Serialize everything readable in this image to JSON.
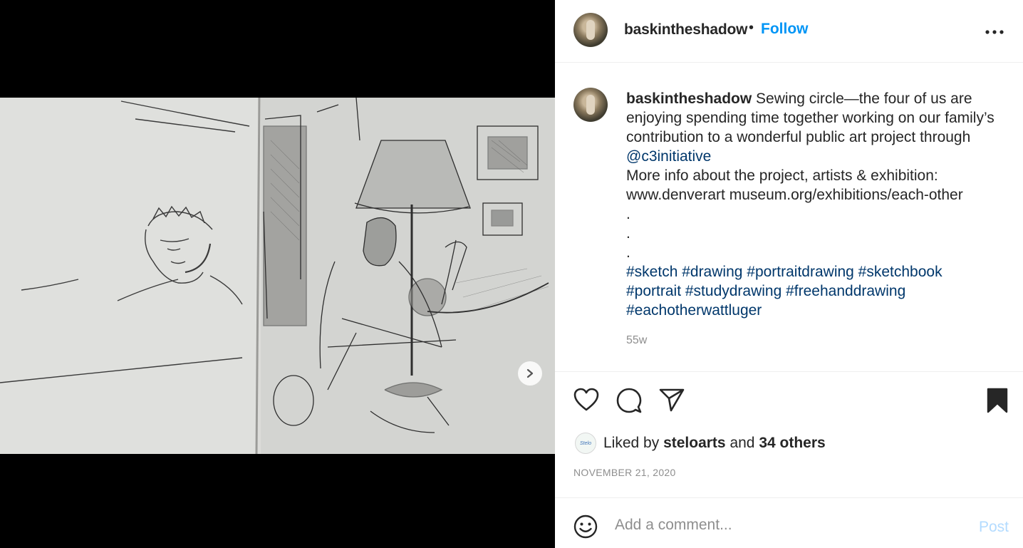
{
  "header": {
    "username": "baskintheshadow",
    "bullet": "•",
    "follow_label": "Follow",
    "more_label": "•••"
  },
  "media": {
    "carousel_slide_count": 3,
    "active_slide": 1
  },
  "caption": {
    "username": "baskintheshadow",
    "line1": "Sewing circle—the four of us are",
    "line2": "enjoying spending time together working on our family’s",
    "line3": "contribution to a wonderful public art project through",
    "mention": "@c3initiative",
    "line5": "More info about the project, artists & exhibition:",
    "line6": "www.denverart museum.org/exhibitions/each-other",
    "dot1": ".",
    "dot2": ".",
    "dot3": ".",
    "hashtags_line1": "#sketch #drawing #portraitdrawing #sketchbook",
    "hashtags_line2": "#portrait #studydrawing #freehanddrawing",
    "hashtags_line3": "#eachotherwattluger",
    "age": "55w"
  },
  "likes": {
    "prefix": "Liked by",
    "user": "steloarts",
    "and": "and",
    "others": "34 others",
    "avatar_text": "Stelo"
  },
  "date": "NOVEMBER 21, 2020",
  "comment": {
    "placeholder": "Add a comment...",
    "post_label": "Post"
  },
  "colors": {
    "follow": "#0095f6",
    "link": "#00376b",
    "muted": "#8e8e8e",
    "post_disabled": "#b3dbff"
  }
}
